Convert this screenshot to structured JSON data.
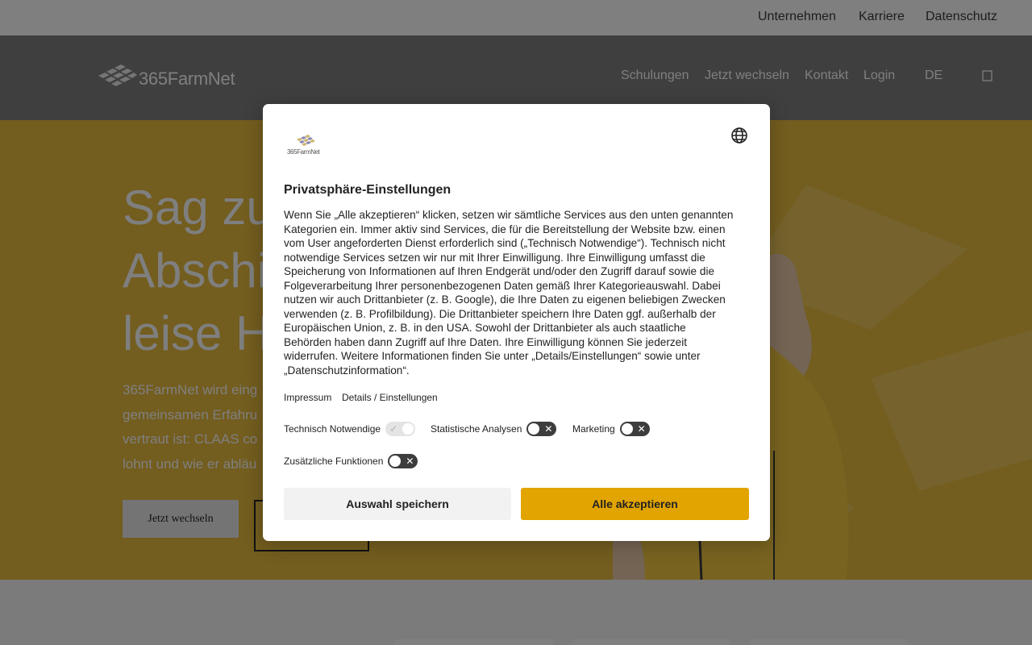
{
  "topbar": {
    "links": [
      "Unternehmen",
      "Karriere",
      "Datenschutz"
    ]
  },
  "header": {
    "logo_text": "365FarmNet",
    "nav": [
      "Schulungen",
      "Jetzt wechseln",
      "Kontakt",
      "Login",
      "DE"
    ],
    "nav_icon": "search-icon"
  },
  "hero": {
    "title_lines": [
      "Sag zu",
      "Abschi",
      "leise H"
    ],
    "text_lines": [
      "365FarmNet wird eing",
      "gemeinsamen Erfahru",
      "vertraut ist: CLAAS co",
      "lohnt und wie er abläu"
    ],
    "button_primary": "Jetzt wechseln",
    "background_color": "#e6bb3e"
  },
  "consent": {
    "logo_text": "365FarmNet",
    "language_icon": "globe-icon",
    "title": "Privatsphäre-Einstellungen",
    "body_lines": [
      "Wenn Sie „Alle akzeptieren“ klicken, setzen wir sämtliche Services aus den unten genannten",
      "Kategorien ein. Immer aktiv sind Services, die für die Bereitstellung der Website bzw. einen",
      "vom User angeforderten Dienst erforderlich sind („Technisch Notwendige“). Technisch nicht",
      "notwendige Services setzen wir nur mit Ihrer Einwilligung. Ihre Einwilligung umfasst die",
      "Speicherung von Informationen auf Ihren Endgerät und/oder den Zugriff darauf sowie die",
      "Folgeverarbeitung Ihrer personenbezogenen Daten gemäß Ihrer Kategorieauswahl. Dabei",
      "nutzen wir auch Drittanbieter (z. B. Google), die Ihre Daten zu eigenen beliebigen Zwecken",
      "verwenden (z. B. Profilbildung). Die Drittanbieter speichern Ihre Daten ggf. außerhalb der",
      "Europäischen Union, z. B. in den USA. Sowohl der Drittanbieter als auch staatliche",
      "Behörden haben dann Zugriff auf Ihre Daten. Ihre Einwilligung können Sie jederzeit",
      "widerrufen. Weitere Informationen finden Sie unter „Details/Einstellungen“ sowie unter",
      "„Datenschutzinformation“."
    ],
    "links": {
      "impressum": "Impressum",
      "details": "Details / Einstellungen"
    },
    "toggles": {
      "technisch": {
        "label": "Technisch Notwendige",
        "state": "on-disabled"
      },
      "statistik": {
        "label": "Statistische Analysen",
        "state": "off"
      },
      "marketing": {
        "label": "Marketing",
        "state": "off"
      },
      "zusatz": {
        "label": "Zusätzliche Funktionen",
        "state": "off"
      }
    },
    "buttons": {
      "save": "Auswahl speichern",
      "accept": "Alle akzeptieren"
    },
    "accent_color": "#e2a400"
  }
}
